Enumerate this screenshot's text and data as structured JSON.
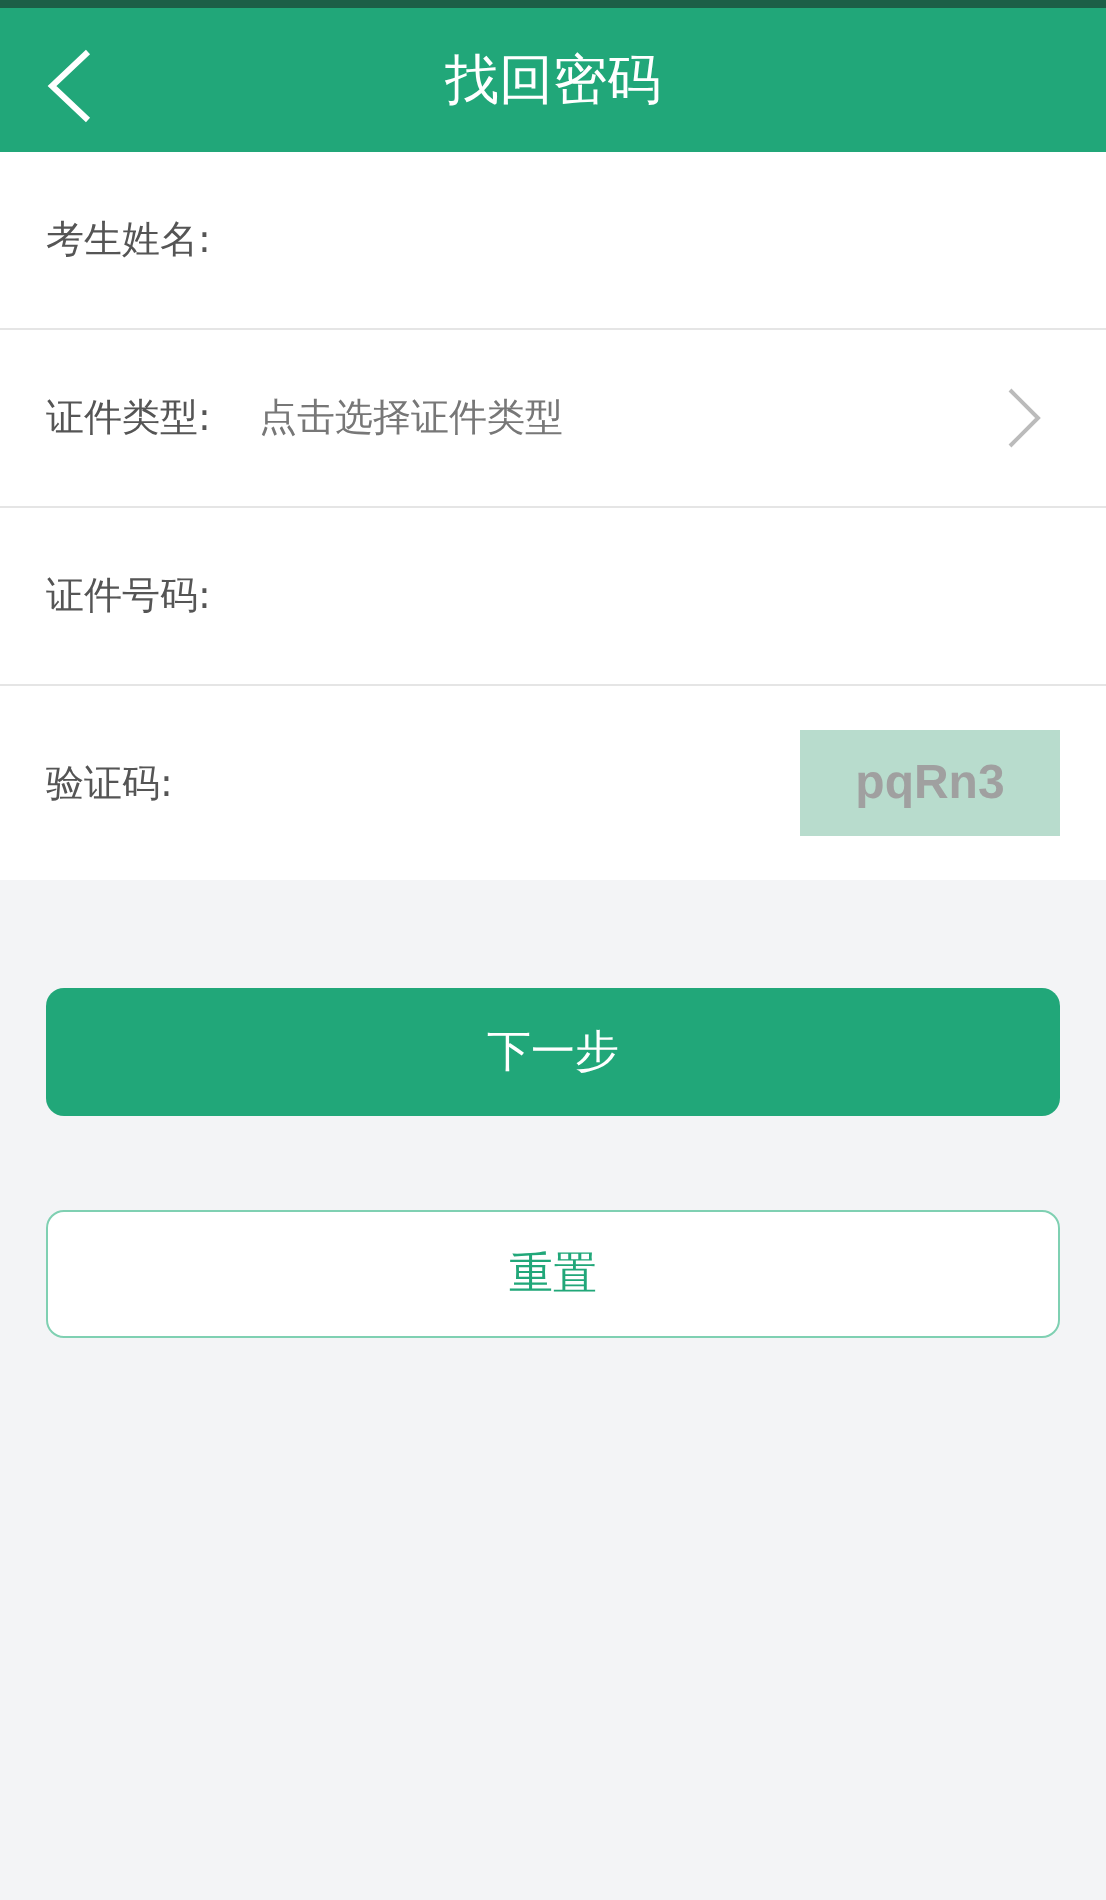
{
  "header": {
    "title": "找回密码"
  },
  "fields": [
    {
      "kind": "text",
      "label": "考生姓名:"
    },
    {
      "kind": "select",
      "label": "证件类型:",
      "placeholder": "点击选择证件类型"
    },
    {
      "kind": "text",
      "label": "证件号码:"
    },
    {
      "kind": "captcha",
      "label": "验证码:",
      "captcha": "pqRn3"
    }
  ],
  "buttons": [
    {
      "kind": "primary",
      "label": "下一步"
    },
    {
      "kind": "secondary",
      "label": "重置"
    }
  ]
}
